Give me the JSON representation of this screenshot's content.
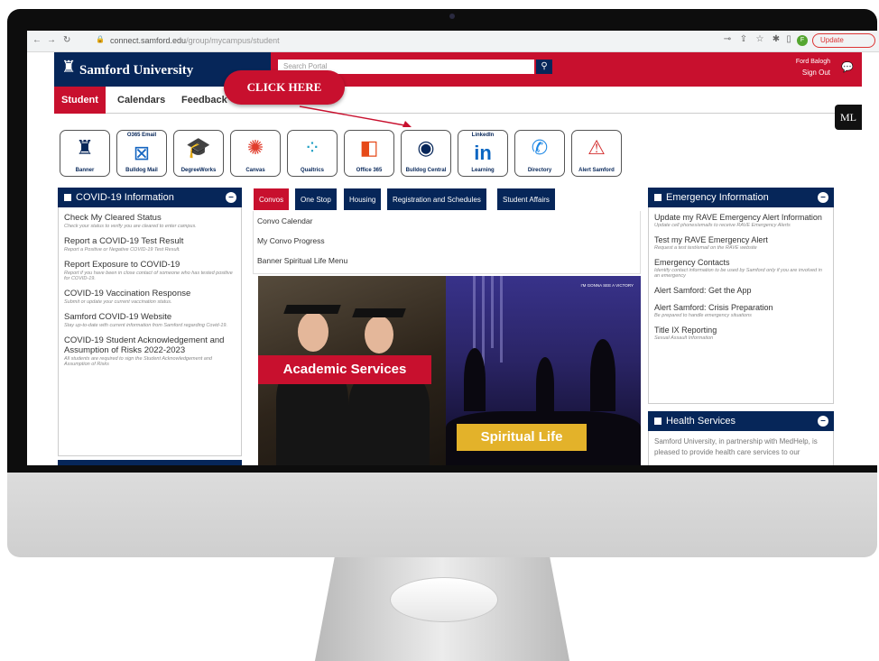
{
  "browser": {
    "url_host": "connect.samford.edu",
    "url_path": "/group/mycampus/student",
    "update_label": "Update",
    "profile_letter": "F"
  },
  "header": {
    "logo_text": "Samford University",
    "search_placeholder": "Search Portal",
    "user_name": "Ford Balogh",
    "sign_out": "Sign Out"
  },
  "portal_tabs": [
    "Student",
    "Calendars",
    "Feedback"
  ],
  "apps": [
    {
      "label": "Banner",
      "icon": "tower-icon"
    },
    {
      "label": "Bulldog Mail",
      "top_label": "O365 Email",
      "icon": "exchange-icon"
    },
    {
      "label": "DegreeWorks",
      "icon": "graduation-cap-icon"
    },
    {
      "label": "Canvas",
      "icon": "canvas-icon"
    },
    {
      "label": "Qualtrics",
      "icon": "qualtrics-icon"
    },
    {
      "label": "Office 365",
      "icon": "office-icon"
    },
    {
      "label": "Bulldog Central",
      "icon": "bulldog-central-icon"
    },
    {
      "label": "Learning",
      "top_label": "LinkedIn",
      "icon": "linkedin-icon"
    },
    {
      "label": "Directory",
      "icon": "phone-icon"
    },
    {
      "label": "Alert Samford",
      "icon": "warning-icon"
    }
  ],
  "callout": {
    "label": "CLICK HERE"
  },
  "side_tag": "ML",
  "covid": {
    "title": "COVID-19 Information",
    "items": [
      {
        "title": "Check My Cleared Status",
        "sub": "Check your status to verify you are cleared to enter campus."
      },
      {
        "title": "Report a COVID-19 Test Result",
        "sub": "Report a Positive or Negative COVID-19 Test Result."
      },
      {
        "title": "Report Exposure to COVID-19",
        "sub": "Report if you have been in close contact of someone who has tested positive for COVID-19."
      },
      {
        "title": "COVID-19 Vaccination Response",
        "sub": "Submit or update your current vaccination status."
      },
      {
        "title": "Samford COVID-19 Website",
        "sub": "Stay up-to-date with current information from Samford regarding Covid-19."
      },
      {
        "title": "COVID-19 Student Acknowledgement and Assumption of Risks 2022-2023",
        "sub": "All students are required to sign the Student Acknowledgement and Assumption of Risks"
      }
    ]
  },
  "center_tabs": [
    "Convos",
    "One Stop",
    "Housing",
    "Registration and Schedules",
    "Student Affairs"
  ],
  "convo_menu": [
    "Convo Calendar",
    "My Convo Progress",
    "Banner Spiritual Life Menu"
  ],
  "tiles": {
    "academic": "Academic Services",
    "spiritual": "Spiritual Life",
    "spiritual_small": "I'M GONNA SEE A VICTORY"
  },
  "emergency": {
    "title": "Emergency Information",
    "items": [
      {
        "title": "Update my RAVE Emergency Alert Information",
        "sub": "Update cell phones/emails to receive RAVE Emergency Alerts"
      },
      {
        "title": "Test my RAVE Emergency Alert",
        "sub": "Request a test text/email on the RAVE website"
      },
      {
        "title": "Emergency Contacts",
        "sub": "Identify contact information to be used by Samford only if you are involved in an emergency"
      },
      {
        "title": "Alert Samford: Get the App",
        "sub": ""
      },
      {
        "title": "Alert Samford: Crisis Preparation",
        "sub": "Be prepared to handle emergency situations"
      },
      {
        "title": "Title IX Reporting",
        "sub": "Sexual Assault Information"
      }
    ]
  },
  "health": {
    "title": "Health Services",
    "text": "Samford University, in partnership with MedHelp, is pleased to provide health care services to our"
  },
  "colors": {
    "navy": "#062659",
    "red": "#c8102e",
    "gold": "#e3b22a"
  }
}
